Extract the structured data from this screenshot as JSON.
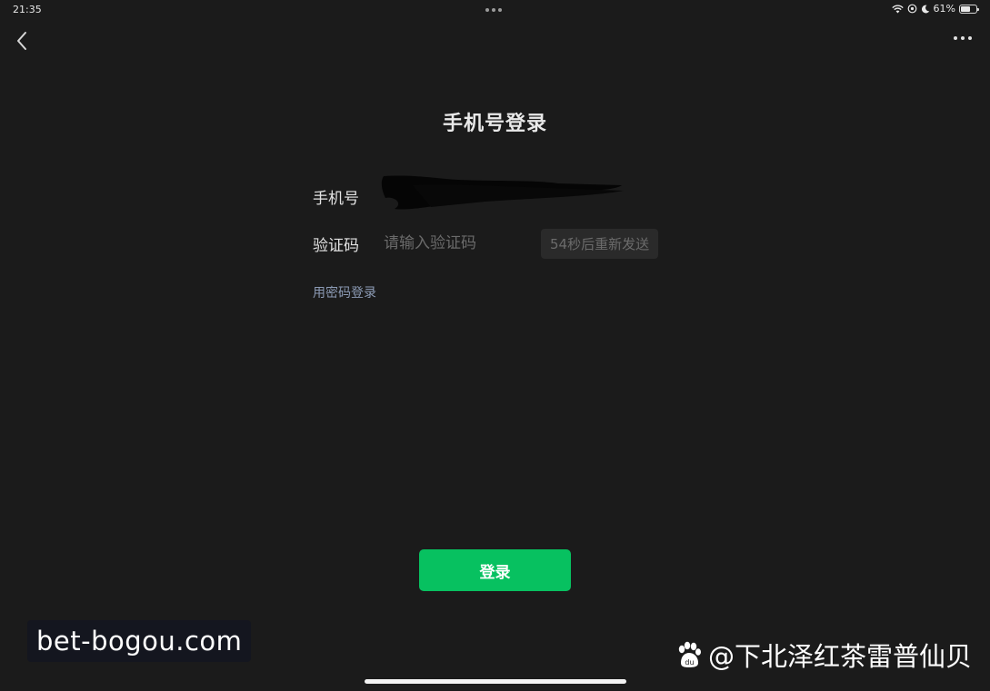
{
  "status_bar": {
    "time": "21:35",
    "battery_percent": "61%",
    "battery_level": 0.61,
    "icons": [
      "wifi-icon",
      "location-icon",
      "moon-icon",
      "battery-icon"
    ]
  },
  "nav": {
    "back_icon": "chevron-left-icon",
    "more_icon": "more-dots-icon"
  },
  "page": {
    "title": "手机号登录"
  },
  "form": {
    "phone_label": "手机号",
    "code_label": "验证码",
    "code_placeholder": "请输入验证码",
    "code_value": "",
    "resend_label": "54秒后重新发送",
    "password_login_link": "用密码登录"
  },
  "login_button": {
    "label": "登录",
    "color": "#07c160"
  },
  "watermarks": {
    "left": "bet-bogou.com",
    "right": "@下北泽红茶雷普仙贝"
  }
}
